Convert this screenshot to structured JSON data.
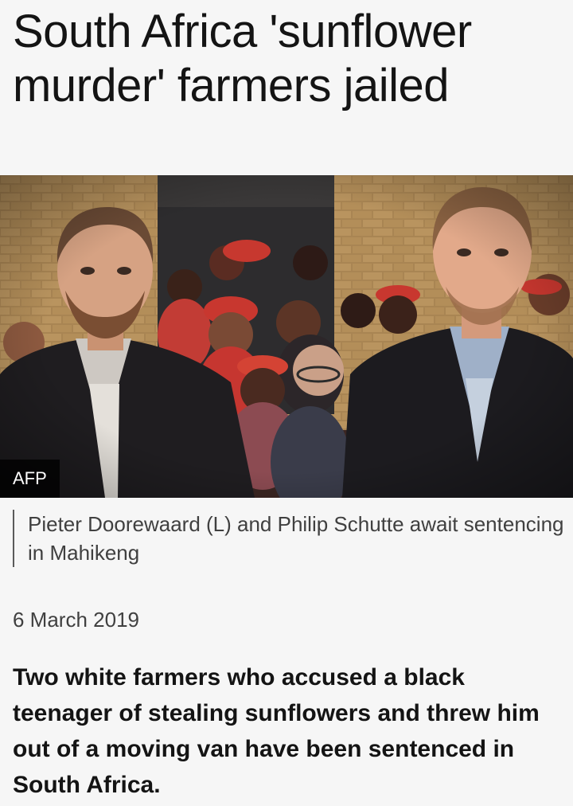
{
  "article": {
    "headline": "South Africa 'sunflower murder' farmers jailed",
    "image": {
      "credit": "AFP",
      "caption": "Pieter Doorewaard (L) and Philip Schutte await sentencing in Mahikeng"
    },
    "date": "6 March 2019",
    "lead": "Two white farmers who accused a black teenager of stealing sunflowers and threw him out of a moving van have been sentenced in South Africa."
  }
}
